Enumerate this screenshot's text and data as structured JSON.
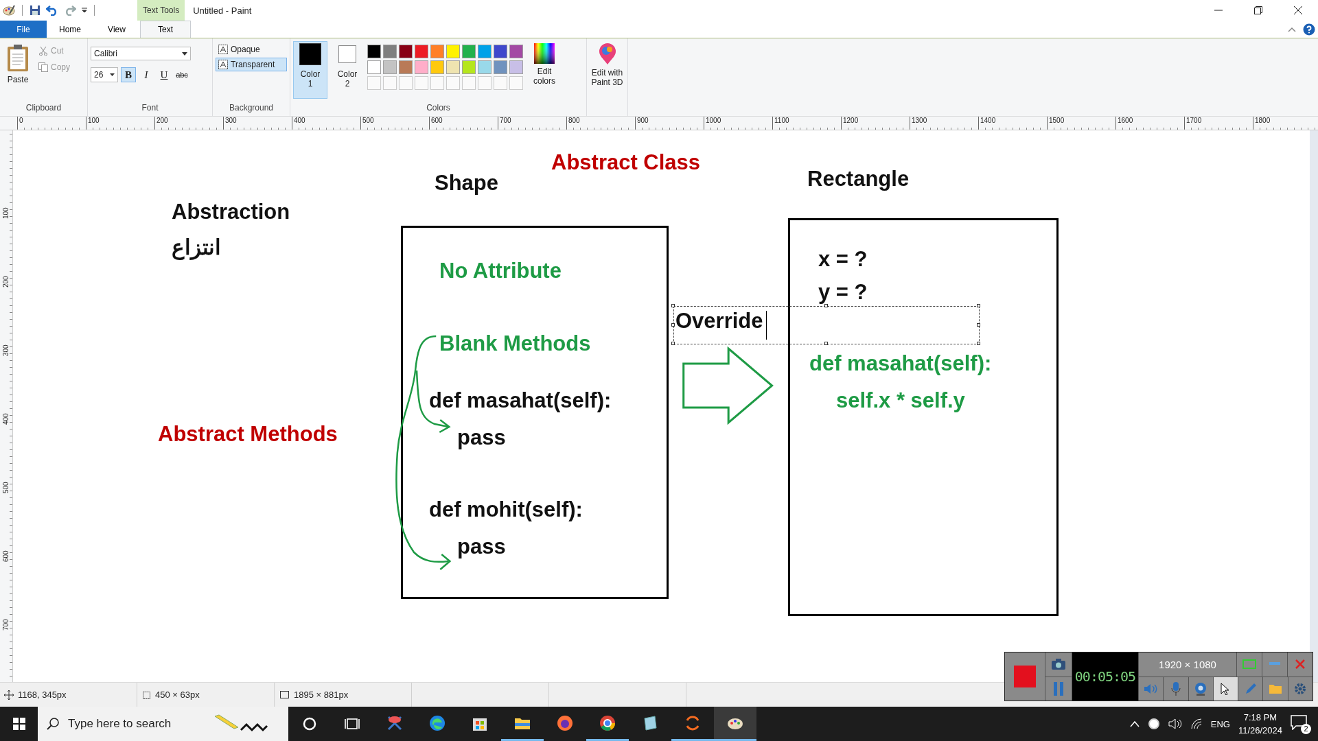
{
  "title_bar": {
    "contextual_tab": "Text Tools",
    "title": "Untitled - Paint"
  },
  "tabs": [
    {
      "label": "File",
      "kind": "file"
    },
    {
      "label": "Home",
      "kind": "tab",
      "selected": false
    },
    {
      "label": "View",
      "kind": "tab",
      "selected": false
    },
    {
      "label": "Text",
      "kind": "tab",
      "selected": true
    }
  ],
  "ribbon": {
    "clipboard": {
      "label": "Clipboard",
      "paste": "Paste",
      "cut": {
        "label": "Cut",
        "disabled": true
      },
      "copy": {
        "label": "Copy",
        "disabled": true
      }
    },
    "font": {
      "label": "Font",
      "family": "Calibri",
      "size": "26",
      "styles": [
        {
          "label": "B",
          "kind": "bold",
          "selected": true
        },
        {
          "label": "I",
          "kind": "italic",
          "selected": false
        },
        {
          "label": "U",
          "kind": "underline",
          "selected": false
        },
        {
          "label": "abc",
          "kind": "strikethrough",
          "selected": false
        }
      ]
    },
    "background": {
      "label": "Background",
      "options": [
        {
          "label": "Opaque",
          "selected": false
        },
        {
          "label": "Transparent",
          "selected": true
        }
      ]
    },
    "colors": {
      "label": "Colors",
      "color1": {
        "label": "Color 1",
        "color": "#000000",
        "selected": true
      },
      "color2": {
        "label": "Color 2",
        "color": "#ffffff",
        "selected": false
      },
      "palette": [
        {
          "color": "#000000"
        },
        {
          "color": "#7f7f7f"
        },
        {
          "color": "#880015"
        },
        {
          "color": "#ed1c24"
        },
        {
          "color": "#ff7f27"
        },
        {
          "color": "#fff200"
        },
        {
          "color": "#22b14c"
        },
        {
          "color": "#00a2e8"
        },
        {
          "color": "#3f48cc"
        },
        {
          "color": "#a349a4"
        },
        {
          "color": "#ffffff"
        },
        {
          "color": "#c3c3c3"
        },
        {
          "color": "#b97a57"
        },
        {
          "color": "#ffaec9"
        },
        {
          "color": "#ffc90e"
        },
        {
          "color": "#efe4b0"
        },
        {
          "color": "#b5e61d"
        },
        {
          "color": "#99d9ea"
        },
        {
          "color": "#7092be"
        },
        {
          "color": "#c8bfe7"
        }
      ],
      "edit_colors": "Edit colors"
    },
    "paint_3d": "Edit with Paint 3D"
  },
  "ruler": {
    "horizontal": [
      "0",
      "100",
      "200",
      "300",
      "400",
      "500",
      "600",
      "700",
      "800",
      "900",
      "1000",
      "1100",
      "1200",
      "1300",
      "1400",
      "1500",
      "1600",
      "1700",
      "1800"
    ],
    "vertical": [
      "100",
      "200",
      "300",
      "400",
      "500",
      "600",
      "700"
    ]
  },
  "canvas": {
    "heading": "Abstract Class",
    "abstraction": "Abstraction",
    "abstraction_fa": "انتزاع",
    "abstract_methods": "Abstract Methods",
    "shape": {
      "title": "Shape",
      "lines": [
        {
          "text": "No Attribute",
          "kind": "note"
        },
        {
          "text": "Blank Methods",
          "kind": "note"
        },
        {
          "text": "def masahat(self):",
          "kind": "code"
        },
        {
          "text": "pass",
          "kind": "code"
        },
        {
          "text": "def mohit(self):",
          "kind": "code"
        },
        {
          "text": "pass",
          "kind": "code"
        }
      ]
    },
    "rectangle": {
      "title": "Rectangle",
      "lines": [
        {
          "text": "x = ?",
          "kind": "code"
        },
        {
          "text": "y = ?",
          "kind": "code"
        },
        {
          "text": "def masahat(self):",
          "kind": "note"
        },
        {
          "text": "self.x * self.y",
          "kind": "note"
        }
      ]
    },
    "text_box": {
      "text": "Override"
    }
  },
  "status_bar": {
    "cursor": "1168, 345px",
    "selection": "450 × 63px",
    "size": "1895 × 881px"
  },
  "recorder": {
    "time": "00:05:05",
    "resolution": "1920 × 1080"
  },
  "taskbar": {
    "search": {
      "placeholder": "Type here to search"
    },
    "apps": [
      {
        "kind": "snip",
        "running": false,
        "selected": false
      },
      {
        "kind": "edge",
        "running": false,
        "selected": false
      },
      {
        "kind": "store",
        "running": false,
        "selected": false
      },
      {
        "kind": "explorer",
        "running": true,
        "selected": false
      },
      {
        "kind": "firefox",
        "running": false,
        "selected": false
      },
      {
        "kind": "chrome",
        "running": true,
        "selected": false
      },
      {
        "kind": "notes",
        "running": false,
        "selected": false
      },
      {
        "kind": "orange",
        "running": true,
        "selected": false
      },
      {
        "kind": "paint",
        "running": true,
        "selected": true
      }
    ],
    "language": "ENG",
    "time": "7:18 PM",
    "date": "11/26/2024",
    "notifications": "2"
  }
}
